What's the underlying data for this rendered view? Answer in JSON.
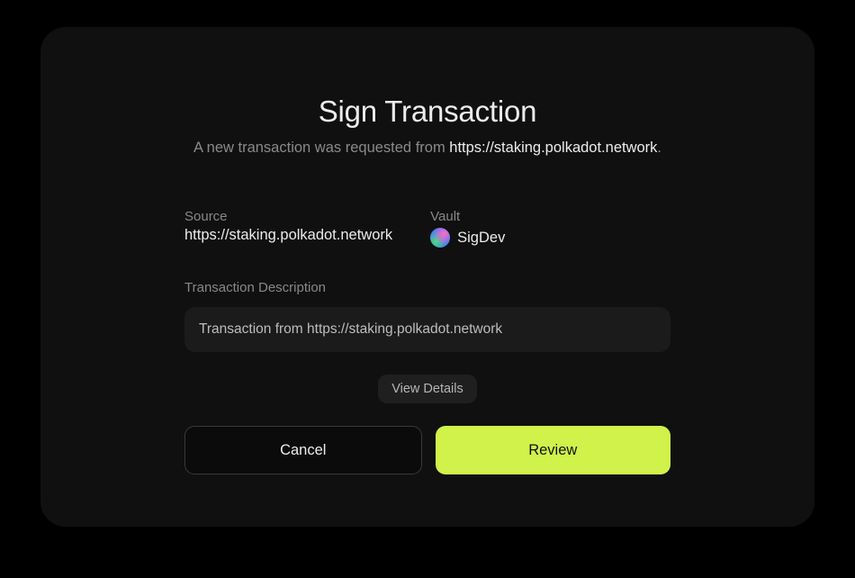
{
  "header": {
    "title": "Sign Transaction",
    "subtitle_prefix": "A new transaction was requested from ",
    "origin": "https://staking.polkadot.network",
    "subtitle_suffix": "."
  },
  "meta": {
    "source_label": "Source",
    "source_value": "https://staking.polkadot.network",
    "vault_label": "Vault",
    "vault_name": "SigDev"
  },
  "description": {
    "label": "Transaction Description",
    "value": "Transaction from https://staking.polkadot.network"
  },
  "buttons": {
    "view_details": "View Details",
    "cancel": "Cancel",
    "review": "Review"
  }
}
